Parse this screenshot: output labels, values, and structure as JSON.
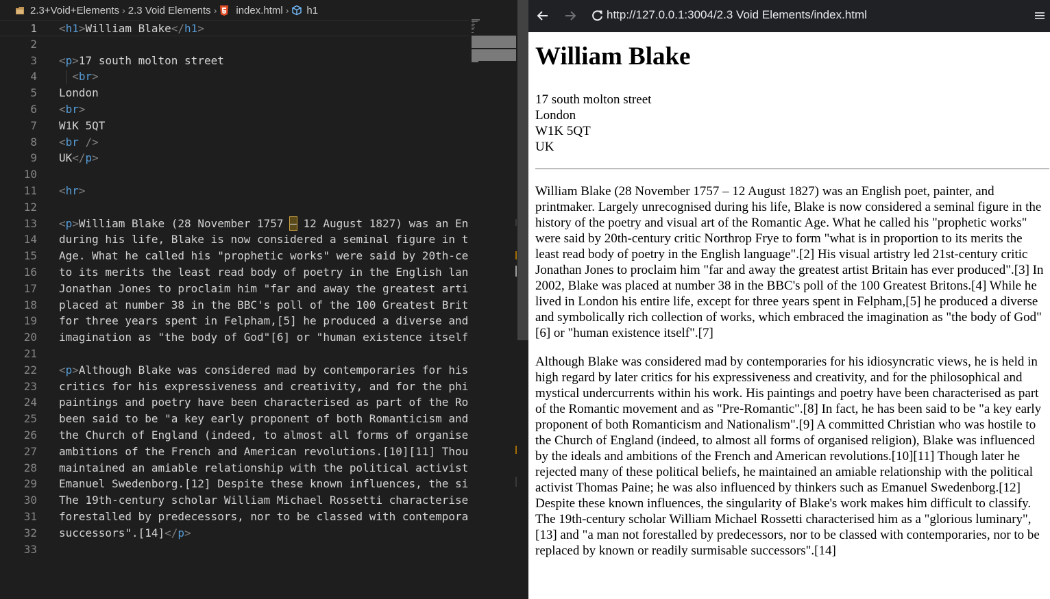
{
  "editor": {
    "breadcrumb": {
      "folder": "2.3+Void+Elements",
      "subfolder": "2.3 Void Elements",
      "file": "index.html",
      "symbol": "h1"
    },
    "lines": [
      {
        "n": "1",
        "html": "<span class=\"tb\">&lt;</span><span class=\"tn\">h1</span><span class=\"tb\">&gt;</span>William Blake<span class=\"tb\">&lt;/</span><span class=\"tn\">h1</span><span class=\"tb\">&gt;</span>"
      },
      {
        "n": "2",
        "html": ""
      },
      {
        "n": "3",
        "html": "<span class=\"tb\">&lt;</span><span class=\"tn\">p</span><span class=\"tb\">&gt;</span>17 south molton street"
      },
      {
        "n": "4",
        "html": "  <span class=\"tb\">&lt;</span><span class=\"tn\">br</span><span class=\"tb\">&gt;</span>"
      },
      {
        "n": "5",
        "html": "London"
      },
      {
        "n": "6",
        "html": "<span class=\"tb\">&lt;</span><span class=\"tn\">br</span><span class=\"tb\">&gt;</span>"
      },
      {
        "n": "7",
        "html": "W1K 5QT"
      },
      {
        "n": "8",
        "html": "<span class=\"tb\">&lt;</span><span class=\"tn\">br</span> <span class=\"tb\">/&gt;</span>"
      },
      {
        "n": "9",
        "html": "UK<span class=\"tb\">&lt;/</span><span class=\"tn\">p</span><span class=\"tb\">&gt;</span>"
      },
      {
        "n": "10",
        "html": ""
      },
      {
        "n": "11",
        "html": "<span class=\"tb\">&lt;</span><span class=\"tn\">hr</span><span class=\"tb\">&gt;</span>"
      },
      {
        "n": "12",
        "html": ""
      },
      {
        "n": "13",
        "html": "<span class=\"tb\">&lt;</span><span class=\"tn\">p</span><span class=\"tb\">&gt;</span>William Blake (28 November 1757 <span class=\"hl\">–</span> 12 August 1827) was an En"
      },
      {
        "n": "14",
        "html": "during his life, Blake is now considered a seminal figure in t"
      },
      {
        "n": "15",
        "html": "Age. What he called his \"prophetic works\" were said by 20th-ce"
      },
      {
        "n": "16",
        "html": "to its merits the least read body of poetry in the English lan"
      },
      {
        "n": "17",
        "html": "Jonathan Jones to proclaim him \"far and away the greatest arti"
      },
      {
        "n": "18",
        "html": "placed at number 38 in the BBC's poll of the 100 Greatest Brit"
      },
      {
        "n": "19",
        "html": "for three years spent in Felpham,[5] he produced a diverse and"
      },
      {
        "n": "20",
        "html": "imagination as \"the body of God\"[6] or \"human existence itself"
      },
      {
        "n": "21",
        "html": ""
      },
      {
        "n": "22",
        "html": "<span class=\"tb\">&lt;</span><span class=\"tn\">p</span><span class=\"tb\">&gt;</span>Although Blake was considered mad by contemporaries for his"
      },
      {
        "n": "23",
        "html": "critics for his expressiveness and creativity, and for the phi"
      },
      {
        "n": "24",
        "html": "paintings and poetry have been characterised as part of the Ro"
      },
      {
        "n": "25",
        "html": "been said to be \"a key early proponent of both Romanticism and"
      },
      {
        "n": "26",
        "html": "the Church of England (indeed, to almost all forms of organise"
      },
      {
        "n": "27",
        "html": "ambitions of the French and American revolutions.[10][11] Thou"
      },
      {
        "n": "28",
        "html": "maintained an amiable relationship with the political activist"
      },
      {
        "n": "29",
        "html": "Emanuel Swedenborg.[12] Despite these known influences, the si"
      },
      {
        "n": "30",
        "html": "The 19th-century scholar William Michael Rossetti characterise"
      },
      {
        "n": "31",
        "html": "forestalled by predecessors, nor to be classed with contempora"
      },
      {
        "n": "32",
        "html": "successors\".[14]<span class=\"tb\">&lt;/</span><span class=\"tn\">p</span><span class=\"tb\">&gt;</span>"
      },
      {
        "n": "33",
        "html": ""
      }
    ]
  },
  "browser": {
    "url": "http://127.0.0.1:3004/2.3 Void Elements/index.html",
    "page": {
      "heading": "William Blake",
      "address": [
        "17 south molton street",
        "London",
        "W1K 5QT",
        "UK"
      ],
      "bio1": "William Blake (28 November 1757 – 12 August 1827) was an English poet, painter, and printmaker. Largely unrecognised during his life, Blake is now considered a seminal figure in the history of the poetry and visual art of the Romantic Age. What he called his \"prophetic works\" were said by 20th-century critic Northrop Frye to form \"what is in proportion to its merits the least read body of poetry in the English language\".[2] His visual artistry led 21st-century critic Jonathan Jones to proclaim him \"far and away the greatest artist Britain has ever produced\".[3] In 2002, Blake was placed at number 38 in the BBC's poll of the 100 Greatest Britons.[4] While he lived in London his entire life, except for three years spent in Felpham,[5] he produced a diverse and symbolically rich collection of works, which embraced the imagination as \"the body of God\"[6] or \"human existence itself\".[7]",
      "bio2": "Although Blake was considered mad by contemporaries for his idiosyncratic views, he is held in high regard by later critics for his expressiveness and creativity, and for the philosophical and mystical undercurrents within his work. His paintings and poetry have been characterised as part of the Romantic movement and as \"Pre-Romantic\".[8] In fact, he has been said to be \"a key early proponent of both Romanticism and Nationalism\".[9] A committed Christian who was hostile to the Church of England (indeed, to almost all forms of organised religion), Blake was influenced by the ideals and ambitions of the French and American revolutions.[10][11] Though later he rejected many of these political beliefs, he maintained an amiable relationship with the political activist Thomas Paine; he was also influenced by thinkers such as Emanuel Swedenborg.[12] Despite these known influences, the singularity of Blake's work makes him difficult to classify. The 19th-century scholar William Michael Rossetti characterised him as a \"glorious luminary\",[13] and \"a man not forestalled by predecessors, nor to be classed with contemporaries, nor to be replaced by known or readily surmisable successors\".[14]"
    }
  },
  "icons": {
    "folder": "folder-icon",
    "html": "html5-icon",
    "symbol": "cube-icon",
    "back": "back-arrow-icon",
    "forward": "forward-arrow-icon",
    "reload": "reload-icon",
    "menu": "menu-icon"
  },
  "colors": {
    "editor_bg": "#1e1e1e",
    "tag_name": "#569cd6",
    "text": "#d4d4d4",
    "line_number": "#858585",
    "html_icon": "#e44d26",
    "browser_toolbar": "#202124"
  }
}
